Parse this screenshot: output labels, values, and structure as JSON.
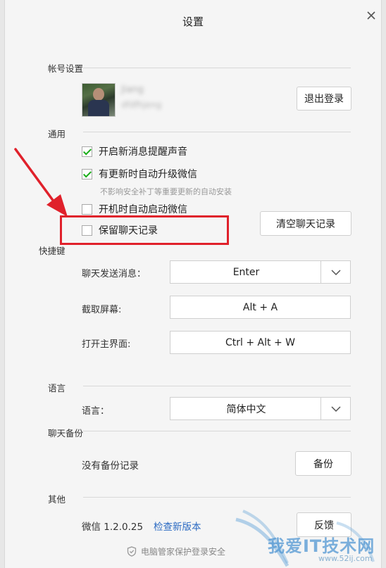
{
  "window": {
    "title": "设置"
  },
  "account": {
    "section_label": "帐号设置",
    "nickname": "Jiang",
    "wechat_id": "dfdfhjeng",
    "logout_label": "退出登录"
  },
  "general": {
    "section_label": "通用",
    "options": [
      {
        "label": "开启新消息提醒声音",
        "checked": true
      },
      {
        "label": "有更新时自动升级微信",
        "checked": true
      },
      {
        "label": "开机时自动启动微信",
        "checked": false
      },
      {
        "label": "保留聊天记录",
        "checked": false
      }
    ],
    "update_hint": "不影响安全补丁等重要更新的自动安装",
    "clear_history_label": "清空聊天记录"
  },
  "shortcuts": {
    "section_label": "快捷键",
    "send_label": "聊天发送消息：",
    "send_value": "Enter",
    "screenshot_label": "截取屏幕:",
    "screenshot_value": "Alt + A",
    "open_main_label": "打开主界面:",
    "open_main_value": "Ctrl + Alt + W"
  },
  "language": {
    "section_label": "语言",
    "label": "语言：",
    "value": "简体中文"
  },
  "backup": {
    "section_label": "聊天备份",
    "status": "没有备份记录",
    "button_label": "备份"
  },
  "other": {
    "section_label": "其他",
    "version": "微信 1.2.0.25",
    "check_update_label": "检查新版本",
    "feedback_label": "反馈"
  },
  "footer": {
    "text": "电脑管家保护登录安全"
  },
  "watermark": {
    "text": "我爱IT技术网",
    "url": "www.52ij.com"
  },
  "colors": {
    "annotation": "#e0212b",
    "check": "#1aad19",
    "link": "#2b6ac2"
  }
}
